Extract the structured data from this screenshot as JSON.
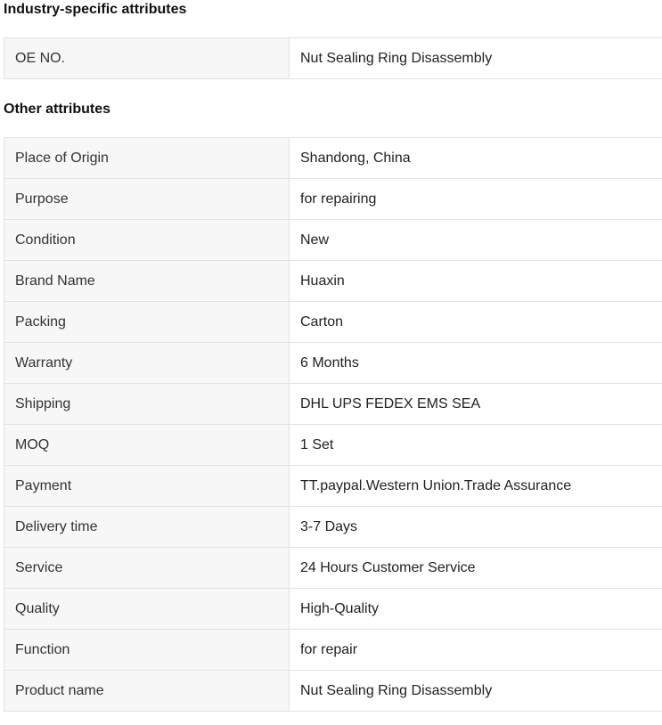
{
  "industry": {
    "title": "Industry-specific attributes",
    "rows": [
      {
        "key": "OE NO.",
        "value": "Nut Sealing Ring Disassembly"
      }
    ]
  },
  "other": {
    "title": "Other attributes",
    "rows": [
      {
        "key": "Place of Origin",
        "value": "Shandong, China"
      },
      {
        "key": "Purpose",
        "value": "for repairing"
      },
      {
        "key": "Condition",
        "value": "New"
      },
      {
        "key": "Brand Name",
        "value": "Huaxin"
      },
      {
        "key": "Packing",
        "value": "Carton"
      },
      {
        "key": "Warranty",
        "value": "6 Months"
      },
      {
        "key": "Shipping",
        "value": "DHL UPS FEDEX EMS SEA"
      },
      {
        "key": "MOQ",
        "value": "1 Set"
      },
      {
        "key": "Payment",
        "value": "TT.paypal.Western Union.Trade Assurance"
      },
      {
        "key": "Delivery time",
        "value": "3-7 Days"
      },
      {
        "key": "Service",
        "value": "24 Hours Customer Service"
      },
      {
        "key": "Quality",
        "value": "High-Quality"
      },
      {
        "key": "Function",
        "value": "for repair"
      },
      {
        "key": "Product name",
        "value": "Nut Sealing Ring Disassembly"
      }
    ]
  }
}
